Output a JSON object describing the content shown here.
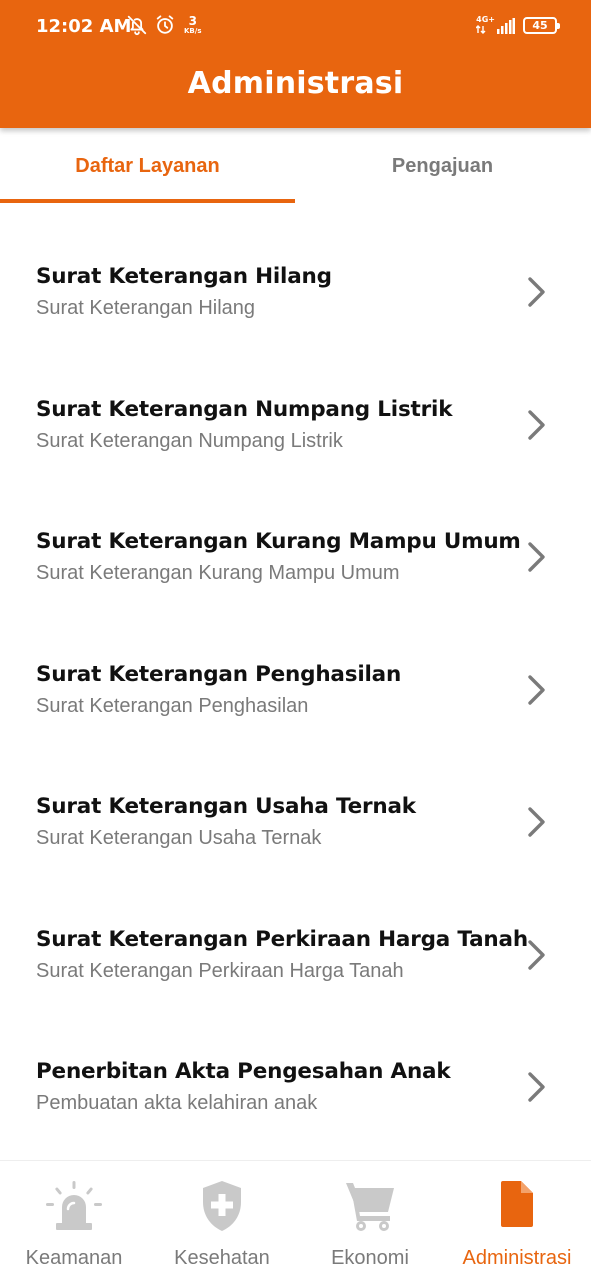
{
  "status_bar": {
    "time": "12:02 AM",
    "net_speed_value": "3",
    "net_speed_unit": "KB/s",
    "network_type": "4G+",
    "battery_level": "45",
    "icons": [
      "bell-off-icon",
      "alarm-icon",
      "signal-icon",
      "battery-icon"
    ]
  },
  "header": {
    "title": "Administrasi",
    "background_color": "#E8650F"
  },
  "tabs": [
    {
      "label": "Daftar Layanan",
      "active": true
    },
    {
      "label": "Pengajuan",
      "active": false
    }
  ],
  "services": [
    {
      "title": "Surat Keterangan Hilang",
      "subtitle": "Surat Keterangan Hilang"
    },
    {
      "title": "Surat Keterangan Numpang Listrik",
      "subtitle": "Surat Keterangan Numpang Listrik"
    },
    {
      "title": "Surat Keterangan Kurang Mampu Umum",
      "subtitle": "Surat Keterangan Kurang Mampu Umum"
    },
    {
      "title": "Surat Keterangan Penghasilan",
      "subtitle": "Surat Keterangan Penghasilan"
    },
    {
      "title": "Surat Keterangan Usaha Ternak",
      "subtitle": "Surat Keterangan Usaha Ternak"
    },
    {
      "title": "Surat Keterangan Perkiraan Harga Tanah",
      "subtitle": "Surat Keterangan Perkiraan Harga Tanah"
    },
    {
      "title": "Penerbitan Akta Pengesahan Anak",
      "subtitle": "Pembuatan akta kelahiran anak"
    }
  ],
  "bottom_nav": [
    {
      "label": "Keamanan",
      "icon": "siren-icon",
      "active": false
    },
    {
      "label": "Kesehatan",
      "icon": "shield-plus-icon",
      "active": false
    },
    {
      "label": "Ekonomi",
      "icon": "cart-icon",
      "active": false
    },
    {
      "label": "Administrasi",
      "icon": "document-icon",
      "active": true
    }
  ],
  "colors": {
    "accent": "#E8650F",
    "inactive": "#7a7a7a",
    "icon_inactive": "#c9c9c9"
  }
}
